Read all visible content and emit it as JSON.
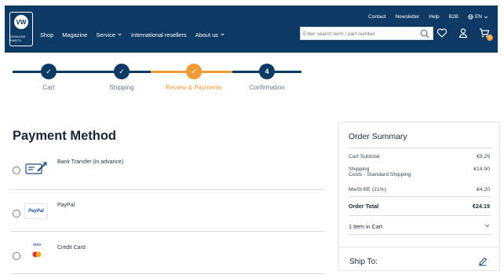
{
  "header": {
    "logo_text": "GENUINE PARTS",
    "top_links": [
      "Contact",
      "Newsletter",
      "Help",
      "B2B"
    ],
    "language": "EN",
    "main_nav": [
      {
        "label": "Shop",
        "has_dropdown": false
      },
      {
        "label": "Magazine",
        "has_dropdown": false
      },
      {
        "label": "Service",
        "has_dropdown": true
      },
      {
        "label": "International resellers",
        "has_dropdown": false
      },
      {
        "label": "About us",
        "has_dropdown": true
      }
    ],
    "search_placeholder": "Enter search term / part number",
    "cart_count": "0",
    "colors": {
      "brand": "#0d3a64",
      "accent": "#f29b38"
    }
  },
  "stepper": {
    "steps": [
      {
        "label": "Cart",
        "state": "done",
        "symbol": "✓"
      },
      {
        "label": "Shipping",
        "state": "done",
        "symbol": "✓"
      },
      {
        "label": "Review & Payments",
        "state": "active",
        "symbol": "✓"
      },
      {
        "label": "Confirmation",
        "state": "todo",
        "symbol": "4"
      }
    ]
  },
  "payment": {
    "title": "Payment Method",
    "options": [
      {
        "label": "Bank Transfer (in advance)",
        "icon": "bank-transfer-icon"
      },
      {
        "label": "PayPal",
        "icon": "paypal-icon",
        "icon_text": "PayPal"
      },
      {
        "label": "Credit Card",
        "icon": "credit-card-icon",
        "icon_text": "VISA"
      }
    ]
  },
  "summary": {
    "title": "Order Summary",
    "rows": [
      {
        "label": "Cart Subtotal",
        "value": "€9.29"
      },
      {
        "label": "Shipping",
        "sublabel": "Costs - Standard Shipping",
        "value": "€14.90"
      },
      {
        "label": "MwSt BE (21%)",
        "value": "€4.20"
      }
    ],
    "total_label": "Order Total",
    "total_value": "€24.19",
    "items_in_cart": "1 Item in Cart"
  },
  "ship_to": {
    "title": "Ship To:"
  }
}
